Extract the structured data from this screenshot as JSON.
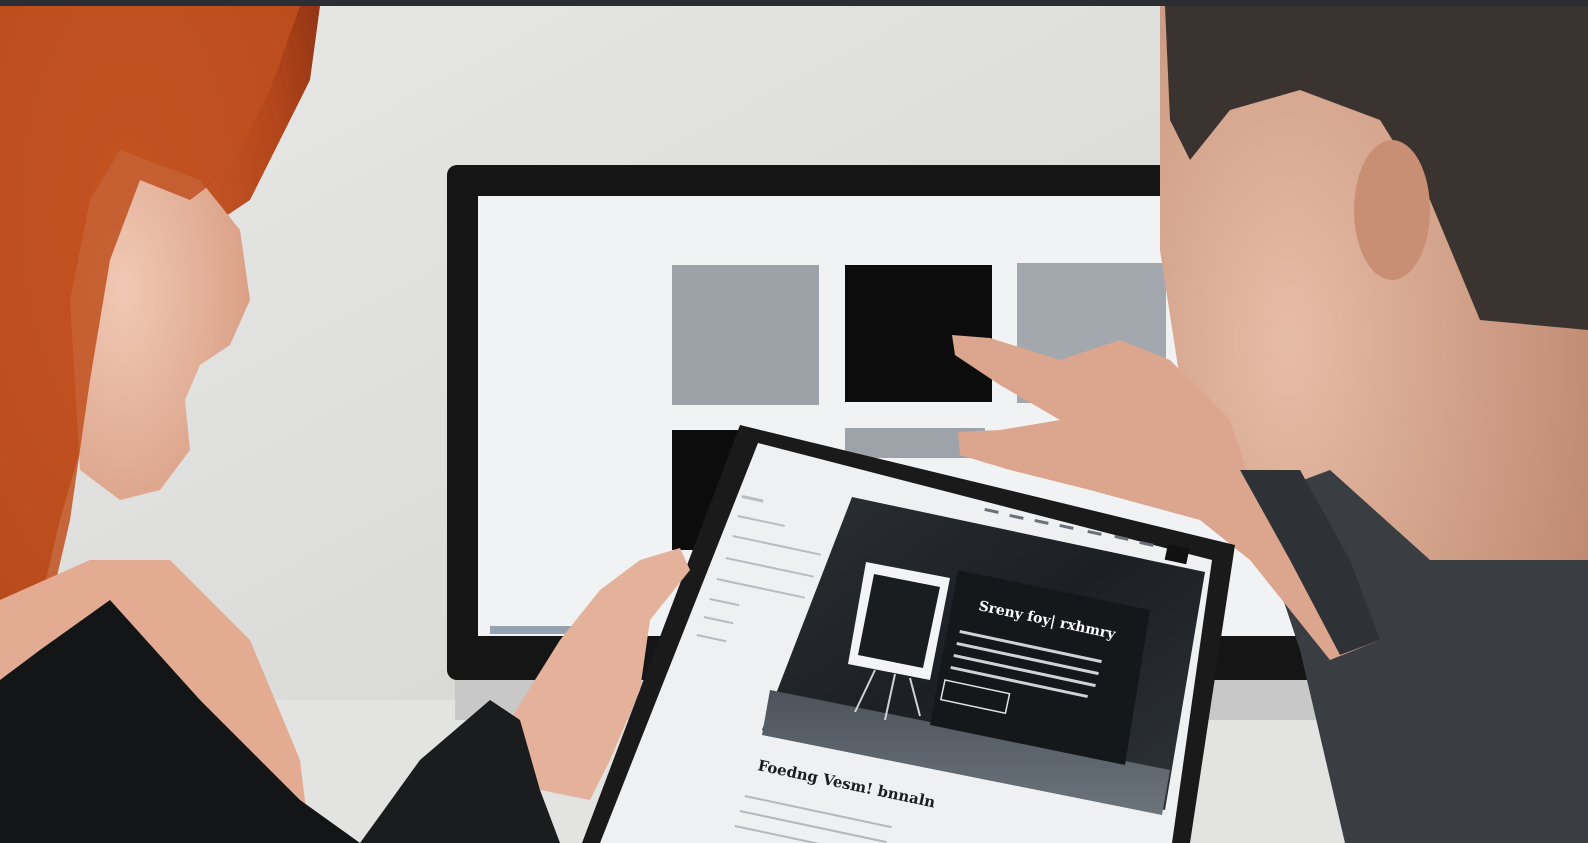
{
  "scene": {
    "type": "photo",
    "subject": "two-people-reviewing-tablet-and-monitor",
    "colors": {
      "wall": "#dcdcda",
      "monitor_bezel": "#141414",
      "monitor_screen": "#f0f1f3",
      "tile_gray": "#9ea3aa",
      "tile_black": "#0b0b0c",
      "tablet_bezel": "#1a1a1b",
      "tablet_screen": "#eef0f2",
      "hero_dark": "#1c1f22",
      "hair_red": "#b5481f",
      "skin": "#e6b49c",
      "shirt_dark": "#2f3336"
    }
  },
  "tablet_page": {
    "hero_title": "Sreny foy| rxhmry",
    "hero_button": "",
    "section_title": "Foedng Vesm! bnnaln"
  }
}
